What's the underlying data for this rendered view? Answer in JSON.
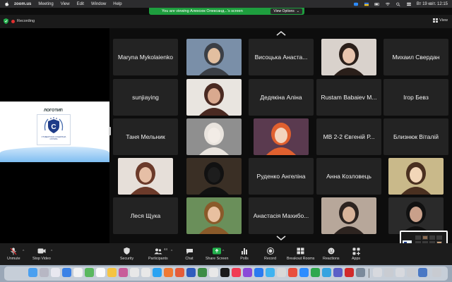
{
  "menubar": {
    "app": "zoom.us",
    "items": [
      "Meeting",
      "View",
      "Edit",
      "Window",
      "Help"
    ],
    "clock": "Вт 19 квіт.  12:15"
  },
  "banner": {
    "text": "You are viewing Алексюк Олександ...'s screen",
    "view_options": "View Options"
  },
  "topbar": {
    "recording": "Recording",
    "view": "View"
  },
  "shared_screen": {
    "logo_label": "ЛОГОТИП",
    "logo_text": "СТУДЕНТСЬКА СОЦІАЛЬНА СЛУЖБА"
  },
  "participants": [
    {
      "name": "Maryna Mykolaienko",
      "type": "name"
    },
    {
      "name": "",
      "type": "photo",
      "icon": "man-in-suit-photo"
    },
    {
      "name": "Висоцька Анаста...",
      "type": "name"
    },
    {
      "name": "",
      "type": "photo",
      "icon": "dark-haired-woman-photo"
    },
    {
      "name": "Михаил Свердан",
      "type": "name"
    },
    {
      "name": "sunjiaying",
      "type": "name"
    },
    {
      "name": "",
      "type": "photo",
      "icon": "woman-headshot-photo"
    },
    {
      "name": "Дедякіна Аліна",
      "type": "name"
    },
    {
      "name": "Rustam Babaiev M...",
      "type": "name"
    },
    {
      "name": "Ігор Бевз",
      "type": "name"
    },
    {
      "name": "Таня Мельник",
      "type": "name"
    },
    {
      "name": "",
      "type": "photo",
      "icon": "white-cat-photo"
    },
    {
      "name": "",
      "type": "photo",
      "icon": "anime-girl-avatar"
    },
    {
      "name": "МВ 2-2 Євгеній Р...",
      "type": "name"
    },
    {
      "name": "Близнюк Віталій",
      "type": "name"
    },
    {
      "name": "",
      "type": "photo",
      "icon": "girl-portrait-photo"
    },
    {
      "name": "",
      "type": "photo",
      "icon": "black-cat-photo"
    },
    {
      "name": "Руденко Ангеліна",
      "type": "name"
    },
    {
      "name": "Анна Козловець",
      "type": "name"
    },
    {
      "name": "",
      "type": "photo",
      "icon": "anime-boy-avatar"
    },
    {
      "name": "Леся Щука",
      "type": "name"
    },
    {
      "name": "",
      "type": "photo",
      "icon": "smiling-woman-photo"
    },
    {
      "name": "Анастасія Махибо...",
      "type": "name"
    },
    {
      "name": "",
      "type": "photo",
      "icon": "woman-hair-photo"
    },
    {
      "name": "",
      "type": "photo",
      "icon": "woman-dark-photo"
    }
  ],
  "toolbar": {
    "unmute": "Unmute",
    "stop_video": "Stop Video",
    "security": "Security",
    "participants": "Participants",
    "participants_count": "44",
    "chat": "Chat",
    "share_screen": "Share Screen",
    "polls": "Polls",
    "record": "Record",
    "breakout_rooms": "Breakout Rooms",
    "reactions": "Reactions",
    "apps": "Apps"
  },
  "colors": {
    "accent_green": "#1e9e3e",
    "share_green": "#23b14d",
    "recording_red": "#e0302f",
    "tile_bg": "#232323"
  }
}
